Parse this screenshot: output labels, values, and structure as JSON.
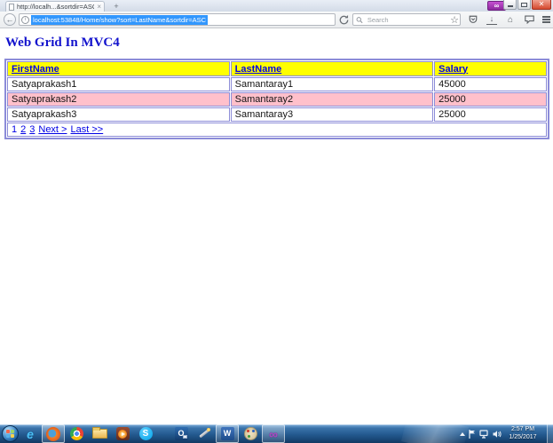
{
  "browser": {
    "tab": {
      "title": "http://localh...&sortdir=ASC",
      "close_glyph": "×"
    },
    "new_tab_glyph": "+",
    "extension_badge_glyph": "∞",
    "back_glyph": "←",
    "info_glyph": "i",
    "url_text": "localhost:53848/Home/show?sort=LastName&sortdir=ASC",
    "search_placeholder": "Search",
    "icon_glyphs": {
      "star": "☆",
      "download": "↓",
      "home": "⌂"
    }
  },
  "page": {
    "heading": "Web Grid In MVC4",
    "grid": {
      "headers": [
        "FirstName",
        "LastName",
        "Salary"
      ],
      "rows": [
        {
          "firstName": "Satyaprakash1",
          "lastName": "Samantaray1",
          "salary": "45000",
          "highlighted": false
        },
        {
          "firstName": "Satyaprakash2",
          "lastName": "Samantaray2",
          "salary": "25000",
          "highlighted": true
        },
        {
          "firstName": "Satyaprakash3",
          "lastName": "Samantaray3",
          "salary": "25000",
          "highlighted": false
        }
      ],
      "pagination": {
        "page1": "1",
        "page2": "2",
        "page3": "3",
        "next": "Next >",
        "last": "Last >>"
      }
    },
    "colors": {
      "grid_border": "#8c8cd8",
      "header_bg": "#ffff00",
      "alt_row_bg": "#ffc0cb",
      "link": "#0000e6",
      "heading": "#1212cd",
      "url_selection_bg": "#3297fd"
    }
  },
  "taskbar": {
    "glyphs": {
      "ie": "e",
      "skype": "S",
      "outlook": "O",
      "word": "W",
      "vs": "∞"
    },
    "items": [
      "start-orb",
      "internet-explorer",
      "firefox",
      "chrome",
      "file-explorer",
      "media-player",
      "skype",
      "outlook",
      "snipping-wand",
      "word",
      "paint",
      "visual-studio"
    ],
    "tray": {
      "time": "2:57 PM",
      "date": "1/25/2017"
    }
  }
}
